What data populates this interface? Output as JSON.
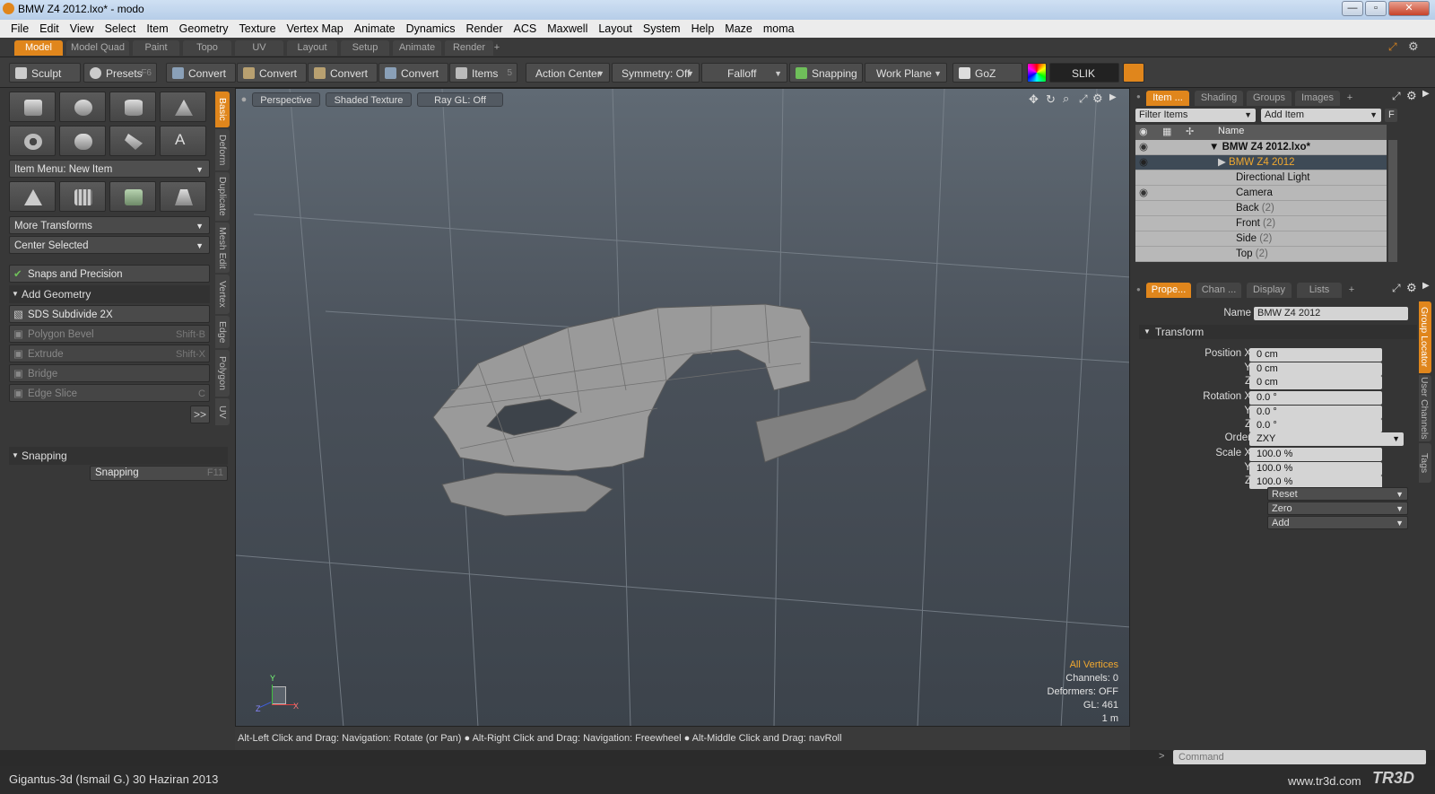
{
  "window": {
    "title": "BMW Z4 2012.lxo* - modo",
    "min": "—",
    "max": "▫",
    "close": "✕"
  },
  "menu": [
    "File",
    "Edit",
    "View",
    "Select",
    "Item",
    "Geometry",
    "Texture",
    "Vertex Map",
    "Animate",
    "Dynamics",
    "Render",
    "ACS",
    "Maxwell",
    "Layout",
    "System",
    "Help",
    "Maze",
    "moma"
  ],
  "layout_tabs": [
    "Model",
    "Model Quad",
    "Paint",
    "Topo",
    "UV",
    "Layout",
    "Setup",
    "Animate",
    "Render",
    "+"
  ],
  "toolbar": {
    "sculpt": "Sculpt",
    "presets": "Presets",
    "presets_key": "F6",
    "convert": "Convert",
    "items": "Items",
    "items_num": "5",
    "action_center": "Action Center",
    "symmetry": "Symmetry: Off",
    "falloff": "Falloff",
    "snapping": "Snapping",
    "work_plane": "Work Plane",
    "goz": "GoZ",
    "slik": "SLIK"
  },
  "left": {
    "item_menu": "Item Menu: New Item",
    "more_transforms": "More Transforms",
    "center_selected": "Center Selected",
    "snaps": "Snaps and Precision",
    "add_geometry": "Add Geometry",
    "ops": [
      {
        "label": "SDS Subdivide 2X",
        "key": ""
      },
      {
        "label": "Polygon Bevel",
        "key": "Shift-B"
      },
      {
        "label": "Extrude",
        "key": "Shift-X"
      },
      {
        "label": "Bridge",
        "key": ""
      },
      {
        "label": "Edge Slice",
        "key": "C"
      }
    ],
    "more": ">>",
    "snapping_header": "Snapping",
    "snapping_btn": "Snapping",
    "snapping_key": "F11",
    "vtabs": [
      "Basic",
      "Deform",
      "Duplicate",
      "Mesh Edit",
      "Vertex",
      "Edge",
      "Polygon",
      "UV"
    ]
  },
  "viewport": {
    "view": "Perspective",
    "shading": "Shaded Texture",
    "raygl": "Ray GL: Off",
    "hud": {
      "all": "All Vertices",
      "channels": "Channels: 0",
      "deformers": "Deformers: OFF",
      "gl": "GL: 461",
      "scale": "1 m"
    },
    "axes": {
      "x": "X",
      "y": "Y",
      "z": "Z"
    }
  },
  "status": "Alt-Left Click and Drag: Navigation: Rotate (or Pan) ● Alt-Right Click and Drag: Navigation: Freewheel ● Alt-Middle Click and Drag: navRoll",
  "items_panel": {
    "tabs": [
      "Item ...",
      "Shading",
      "Groups",
      "Images",
      "+"
    ],
    "filter": "Filter Items",
    "add_item": "Add Item",
    "f": "F",
    "name_col": "Name",
    "rows": [
      {
        "name": "BMW Z4 2012.lxo*",
        "count": ""
      },
      {
        "name": "BMW Z4 2012",
        "count": ""
      },
      {
        "name": "Directional Light",
        "count": ""
      },
      {
        "name": "Camera",
        "count": ""
      },
      {
        "name": "Back",
        "count": "(2)"
      },
      {
        "name": "Front",
        "count": "(2)"
      },
      {
        "name": "Side",
        "count": "(2)"
      },
      {
        "name": "Top",
        "count": "(2)"
      }
    ]
  },
  "props_panel": {
    "tabs": [
      "Prope...",
      "Chan ...",
      "Display",
      "Lists",
      "+"
    ],
    "name_label": "Name",
    "name_value": "BMW Z4 2012",
    "transform": "Transform",
    "fields": [
      {
        "label": "Position X",
        "value": "0 cm"
      },
      {
        "label": "Y",
        "value": "0 cm"
      },
      {
        "label": "Z",
        "value": "0 cm"
      },
      {
        "label": "Rotation X",
        "value": "0.0 °"
      },
      {
        "label": "Y",
        "value": "0.0 °"
      },
      {
        "label": "Z",
        "value": "0.0 °"
      },
      {
        "label": "Order",
        "value": "ZXY"
      },
      {
        "label": "Scale X",
        "value": "100.0 %"
      },
      {
        "label": "Y",
        "value": "100.0 %"
      },
      {
        "label": "Z",
        "value": "100.0 %"
      }
    ],
    "buttons": [
      "Reset",
      "Zero",
      "Add"
    ],
    "vtabs": [
      "Group Locator",
      "User Channels",
      "Tags"
    ]
  },
  "command": {
    "placeholder": "Command"
  },
  "footer": {
    "left": "Gigantus-3d (Ismail G.) 30 Haziran 2013",
    "right": "www.tr3d.com",
    "logo": "TR3D"
  }
}
